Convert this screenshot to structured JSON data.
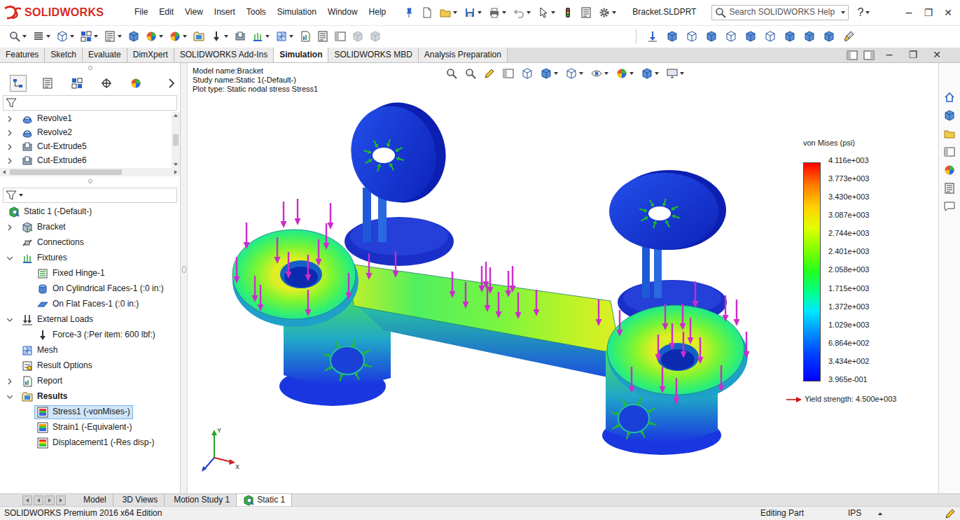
{
  "window": {
    "title": "Bracket.SLDPRT",
    "logo": "SOLIDWORKS",
    "help": "?",
    "controls": [
      "−",
      "❐",
      "✕"
    ]
  },
  "menu": [
    "File",
    "Edit",
    "View",
    "Insert",
    "Tools",
    "Simulation",
    "Window",
    "Help"
  ],
  "search": {
    "placeholder": "Search SOLIDWORKS Help"
  },
  "command_tabs": [
    {
      "label": "Features",
      "selected": false
    },
    {
      "label": "Sketch",
      "selected": false
    },
    {
      "label": "Evaluate",
      "selected": false
    },
    {
      "label": "DimXpert",
      "selected": false
    },
    {
      "label": "SOLIDWORKS Add-Ins",
      "selected": false
    },
    {
      "label": "Simulation",
      "selected": true
    },
    {
      "label": "SOLIDWORKS MBD",
      "selected": false
    },
    {
      "label": "Analysis Preparation",
      "selected": false
    }
  ],
  "document_controls": [
    "−",
    "❐",
    "✕"
  ],
  "panel_tabs": [
    {
      "selected": true
    },
    {
      "selected": false
    },
    {
      "selected": false
    },
    {
      "selected": false
    },
    {
      "selected": false
    }
  ],
  "feature_tree": [
    {
      "label": "Revolve1",
      "kind": "revolve",
      "expandable": true,
      "expanded": false,
      "selected": false
    },
    {
      "label": "Revolve2",
      "kind": "revolve",
      "expandable": true,
      "expanded": false,
      "selected": false
    },
    {
      "label": "Cut-Extrude5",
      "kind": "cut",
      "expandable": true,
      "expanded": false,
      "selected": false
    },
    {
      "label": "Cut-Extrude6",
      "kind": "cut",
      "expandable": true,
      "expanded": false,
      "selected": false
    }
  ],
  "sim_tree": {
    "root": {
      "label": "Static 1 (-Default-)",
      "kind": "study",
      "selected": false
    },
    "nodes": [
      {
        "label": "Bracket",
        "kind": "part",
        "expandable": true,
        "expanded": false,
        "bold": false,
        "selected": false,
        "children": []
      },
      {
        "label": "Connections",
        "kind": "conn",
        "expandable": false,
        "expanded": false,
        "bold": false,
        "selected": false,
        "children": []
      },
      {
        "label": "Fixtures",
        "kind": "fix",
        "expandable": true,
        "expanded": true,
        "bold": false,
        "selected": false,
        "children": [
          {
            "label": "Fixed Hinge-1",
            "kind": "hinge",
            "selected": false
          },
          {
            "label": "On Cylindrical Faces-1 (:0 in:)",
            "kind": "cyl",
            "selected": false
          },
          {
            "label": "On Flat Faces-1 (:0 in:)",
            "kind": "flat",
            "selected": false
          }
        ]
      },
      {
        "label": "External Loads",
        "kind": "loads",
        "expandable": true,
        "expanded": true,
        "bold": false,
        "selected": false,
        "children": [
          {
            "label": "Force-3 (:Per item: 600 lbf:)",
            "kind": "force",
            "selected": false
          }
        ]
      },
      {
        "label": "Mesh",
        "kind": "mesh",
        "expandable": false,
        "expanded": false,
        "bold": false,
        "selected": false,
        "children": []
      },
      {
        "label": "Result Options",
        "kind": "opts",
        "expandable": false,
        "expanded": false,
        "bold": false,
        "selected": false,
        "children": []
      },
      {
        "label": "Report",
        "kind": "report",
        "expandable": true,
        "expanded": false,
        "bold": false,
        "selected": false,
        "children": []
      },
      {
        "label": "Results",
        "kind": "results",
        "expandable": true,
        "expanded": true,
        "bold": true,
        "selected": false,
        "children": [
          {
            "label": "Stress1 (-vonMises-)",
            "kind": "plot-stress",
            "selected": true
          },
          {
            "label": "Strain1 (-Equivalent-)",
            "kind": "plot-strain",
            "selected": false
          },
          {
            "label": "Displacement1 (-Res disp-)",
            "kind": "plot-disp",
            "selected": false
          }
        ]
      }
    ]
  },
  "viewport": {
    "info": [
      "Model name:Bracket",
      "Study name:Static 1(-Default-)",
      "Plot type: Static nodal stress Stress1"
    ],
    "triad": {
      "x": "X",
      "y": "Y"
    }
  },
  "legend": {
    "title": "von Mises (psi)",
    "ticks": [
      "4.116e+003",
      "3.773e+003",
      "3.430e+003",
      "3.087e+003",
      "2.744e+003",
      "2.401e+003",
      "2.058e+003",
      "1.715e+003",
      "1.372e+003",
      "1.029e+003",
      "6.864e+002",
      "3.434e+002",
      "3.965e-001"
    ],
    "yield": "Yield strength: 4.500e+003"
  },
  "bottom_tabs": [
    {
      "label": "Model",
      "kind": "plain",
      "selected": false
    },
    {
      "label": "3D Views",
      "kind": "plain",
      "selected": false
    },
    {
      "label": "Motion Study 1",
      "kind": "plain",
      "selected": false
    },
    {
      "label": "Static 1",
      "kind": "study",
      "selected": true
    }
  ],
  "status_bar": {
    "edition": "SOLIDWORKS Premium 2016 x64 Edition",
    "mode": "Editing Part",
    "units": "IPS"
  }
}
